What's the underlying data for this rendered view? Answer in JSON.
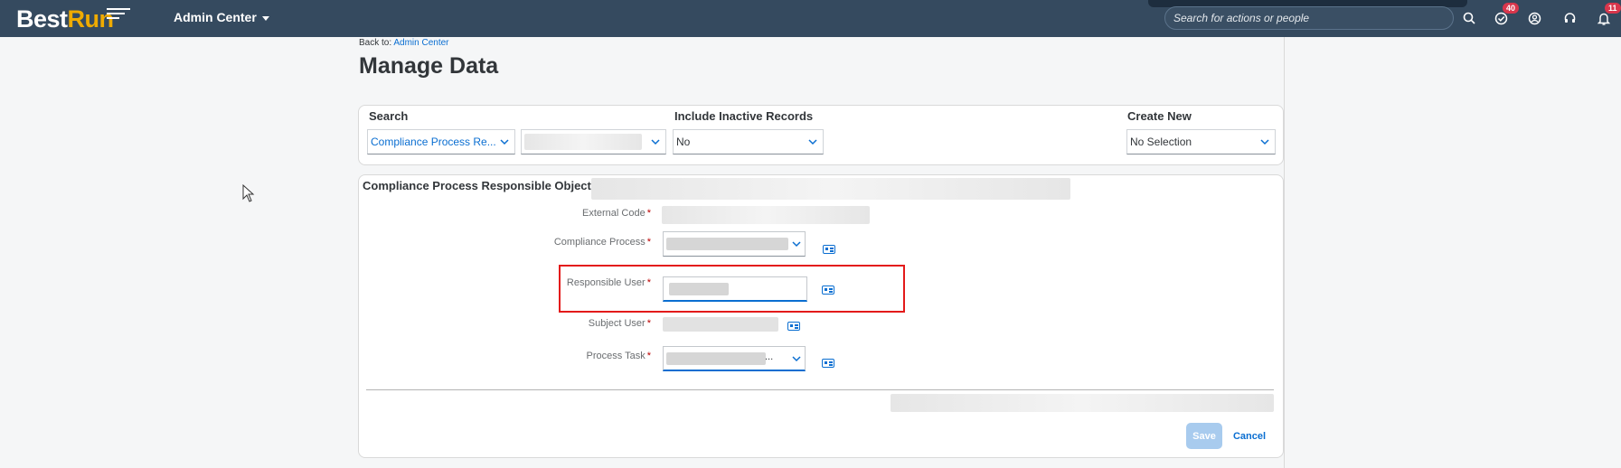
{
  "shell": {
    "logo_best": "Best",
    "logo_run": "Run",
    "app_title": "Admin Center",
    "search_placeholder": "Search for actions or people",
    "todo_badge": "40",
    "notifications_badge": "11"
  },
  "page": {
    "back_prefix": "Back to: ",
    "back_link": "Admin Center",
    "title": "Manage Data"
  },
  "search_panel": {
    "search_label": "Search",
    "object_type_value": "Compliance Process Re...",
    "inactive_label": "Include Inactive Records",
    "inactive_value": "No",
    "create_new_label": "Create New",
    "create_new_value": "No Selection"
  },
  "detail": {
    "object_title": "Compliance Process Responsible Object:",
    "fields": {
      "external_code": "External Code",
      "compliance_process": "Compliance Process",
      "responsible_user": "Responsible User",
      "subject_user": "Subject User",
      "process_task": "Process Task",
      "process_task_ellipsis": "..."
    },
    "required_marker": "*",
    "save_label": "Save",
    "cancel_label": "Cancel"
  },
  "colors": {
    "shell_bg": "#354a5f",
    "accent": "#0a6ed1",
    "highlight": "#e31a1a",
    "logo_accent": "#f0ab00"
  }
}
